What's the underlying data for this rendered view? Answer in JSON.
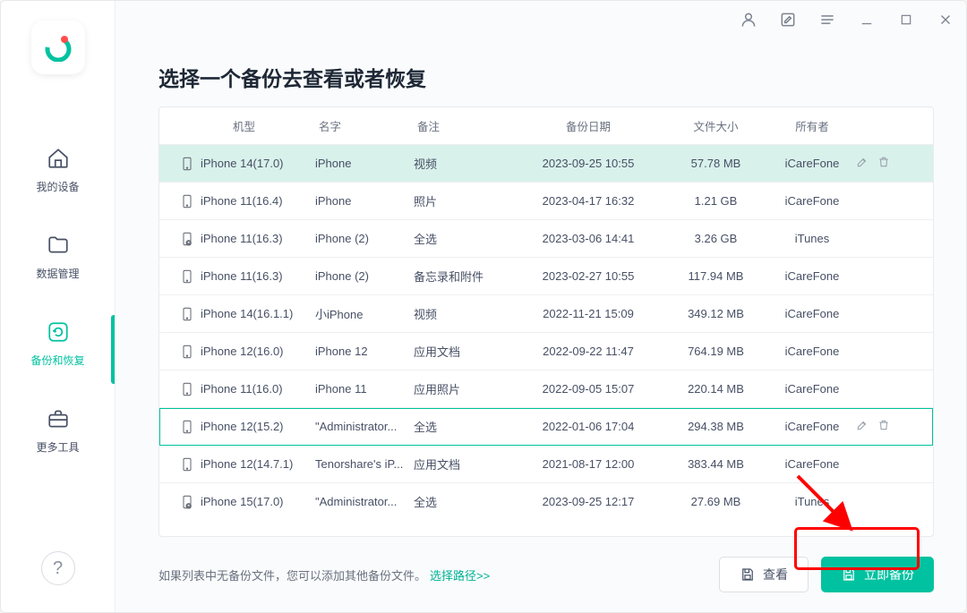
{
  "sidebar": {
    "items": [
      {
        "label": "我的设备"
      },
      {
        "label": "数据管理"
      },
      {
        "label": "备份和恢复"
      },
      {
        "label": "更多工具"
      }
    ]
  },
  "titlebar": {},
  "title": "选择一个备份去查看或者恢复",
  "table": {
    "headers": {
      "model": "机型",
      "name": "名字",
      "note": "备注",
      "date": "备份日期",
      "size": "文件大小",
      "owner": "所有者"
    },
    "rows": [
      {
        "icon": "phone",
        "model": "iPhone 14(17.0)",
        "name": "iPhone",
        "note": "视频",
        "date": "2023-09-25 10:55",
        "size": "57.78 MB",
        "owner": "iCareFone",
        "selected": true,
        "show_actions": true
      },
      {
        "icon": "phone",
        "model": "iPhone 11(16.4)",
        "name": "iPhone",
        "note": "照片",
        "date": "2023-04-17 16:32",
        "size": "1.21 GB",
        "owner": "iCareFone"
      },
      {
        "icon": "itunes",
        "model": "iPhone 11(16.3)",
        "name": "iPhone (2)",
        "note": "全选",
        "date": "2023-03-06 14:41",
        "size": "3.26 GB",
        "owner": "iTunes"
      },
      {
        "icon": "phone",
        "model": "iPhone 11(16.3)",
        "name": "iPhone (2)",
        "note": "备忘录和附件",
        "date": "2023-02-27 10:55",
        "size": "117.94 MB",
        "owner": "iCareFone"
      },
      {
        "icon": "phone",
        "model": "iPhone 14(16.1.1)",
        "name": "小iPhone",
        "note": "视频",
        "date": "2022-11-21 15:09",
        "size": "349.12 MB",
        "owner": "iCareFone"
      },
      {
        "icon": "phone",
        "model": "iPhone 12(16.0)",
        "name": "iPhone 12",
        "note": "应用文档",
        "date": "2022-09-22 11:47",
        "size": "764.19 MB",
        "owner": "iCareFone"
      },
      {
        "icon": "phone",
        "model": "iPhone 11(16.0)",
        "name": "iPhone 11",
        "note": "应用照片",
        "date": "2022-09-05 15:07",
        "size": "220.14 MB",
        "owner": "iCareFone"
      },
      {
        "icon": "phone",
        "model": "iPhone 12(15.2)",
        "name": "\"Administrator...",
        "note": "全选",
        "date": "2022-01-06 17:04",
        "size": "294.38 MB",
        "owner": "iCareFone",
        "highlighted": true,
        "show_actions": true
      },
      {
        "icon": "phone",
        "model": "iPhone 12(14.7.1)",
        "name": "Tenorshare's iP...",
        "note": "应用文档",
        "date": "2021-08-17 12:00",
        "size": "383.44 MB",
        "owner": "iCareFone"
      },
      {
        "icon": "itunes",
        "model": "iPhone 15(17.0)",
        "name": "\"Administrator...",
        "note": "全选",
        "date": "2023-09-25 12:17",
        "size": "27.69 MB",
        "owner": "iTunes"
      }
    ]
  },
  "footer": {
    "text": "如果列表中无备份文件，您可以添加其他备份文件。",
    "link": "选择路径>>",
    "view": "查看",
    "backup": "立即备份"
  }
}
